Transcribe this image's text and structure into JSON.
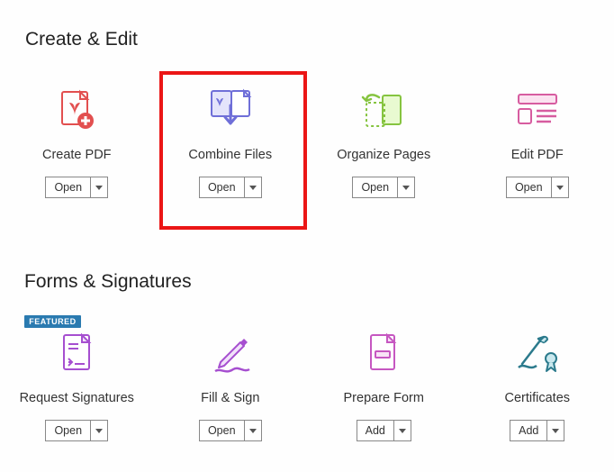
{
  "sections": {
    "create_edit": {
      "title": "Create & Edit",
      "tools": [
        {
          "label": "Create PDF",
          "button": "Open"
        },
        {
          "label": "Combine Files",
          "button": "Open",
          "highlighted": true
        },
        {
          "label": "Organize Pages",
          "button": "Open"
        },
        {
          "label": "Edit PDF",
          "button": "Open"
        }
      ]
    },
    "forms_signatures": {
      "title": "Forms & Signatures",
      "tools": [
        {
          "label": "Request Signatures",
          "button": "Open",
          "badge": "FEATURED"
        },
        {
          "label": "Fill & Sign",
          "button": "Open"
        },
        {
          "label": "Prepare Form",
          "button": "Add"
        },
        {
          "label": "Certificates",
          "button": "Add"
        }
      ]
    }
  }
}
